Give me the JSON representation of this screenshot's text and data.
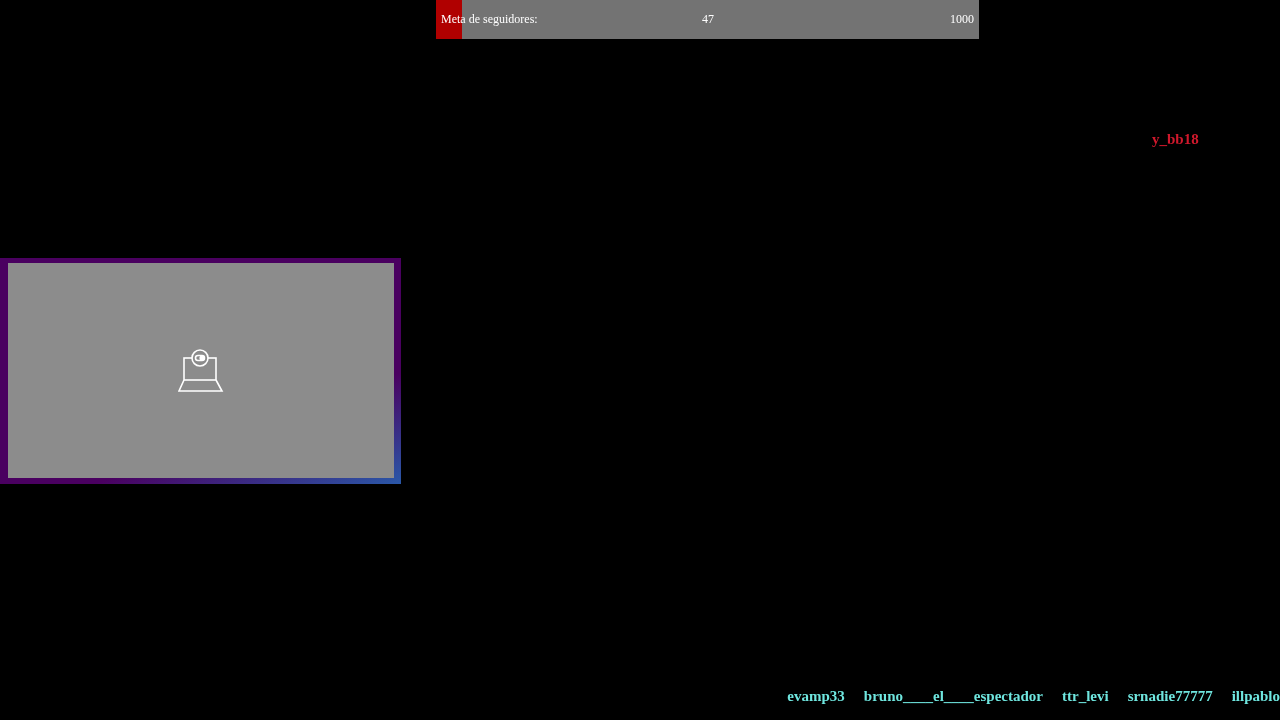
{
  "follower_goal": {
    "label": "Meta de seguidores:",
    "current": "47",
    "target": "1000",
    "level": 0.047
  },
  "latest_follower": {
    "name": "y_bb18"
  },
  "ticker": [
    "evamp33",
    "bruno____el____espectador",
    "ttr_levi",
    "srnadie77777",
    "illpablo"
  ]
}
